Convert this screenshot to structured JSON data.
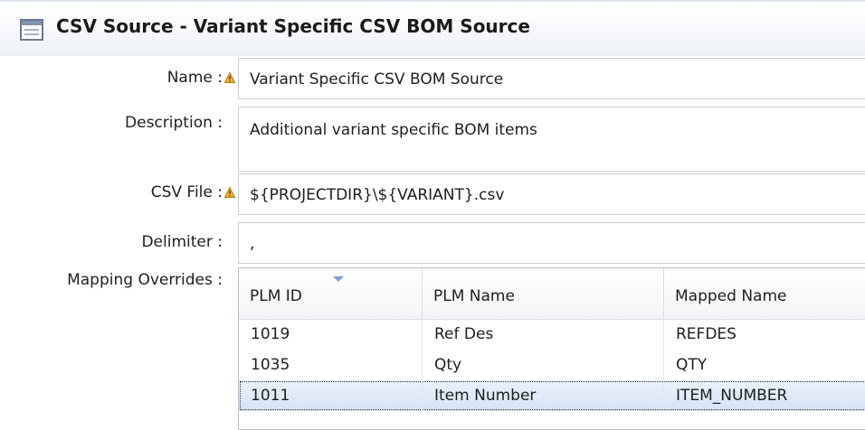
{
  "header": {
    "title": "CSV Source - Variant Specific CSV BOM Source",
    "icon": "form-table-icon"
  },
  "form": {
    "name_label": "Name :",
    "name_value": "Variant Specific CSV BOM Source",
    "description_label": "Description :",
    "description_value": "Additional variant specific BOM items",
    "csv_file_label": "CSV File :",
    "csv_file_value": "${PROJECTDIR}\\${VARIANT}.csv",
    "delimiter_label": "Delimiter :",
    "delimiter_value": ",",
    "mapping_label": "Mapping Overrides :"
  },
  "table": {
    "columns": [
      "PLM ID",
      "PLM Name",
      "Mapped Name"
    ],
    "sorted_column": "PLM ID",
    "rows": [
      {
        "plm_id": "1019",
        "plm_name": "Ref Des",
        "mapped_name": "REFDES"
      },
      {
        "plm_id": "1035",
        "plm_name": "Qty",
        "mapped_name": "QTY"
      },
      {
        "plm_id": "1011",
        "plm_name": "Item Number",
        "mapped_name": "ITEM_NUMBER",
        "selected": true
      }
    ]
  },
  "colors": {
    "warning": "#f0a020",
    "selection": "#d6e4f6",
    "header_bg": "#eef2f8"
  }
}
